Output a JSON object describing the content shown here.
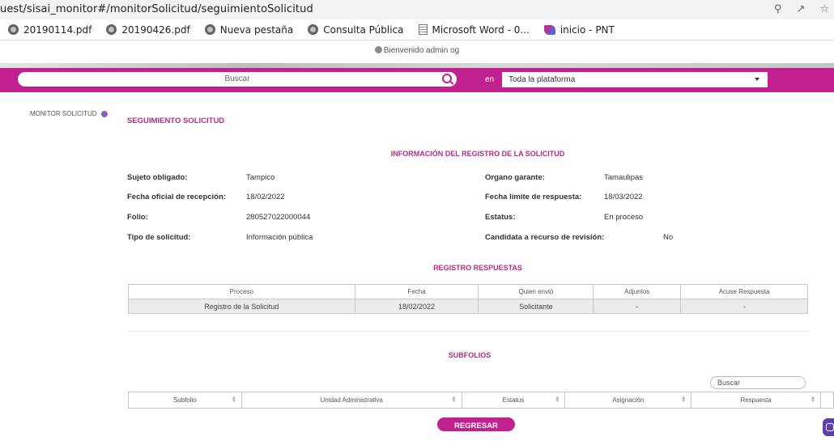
{
  "browser": {
    "url": "uest/sisai_monitor#/monitorSolicitud/seguimientoSolicitud",
    "bookmarks": [
      "20190114.pdf",
      "20190426.pdf",
      "Nueva pestaña",
      "Consulta Pública",
      "Microsoft Word - 0...",
      "inicio - PNT"
    ]
  },
  "header": {
    "welcome": "Bienvenido admin og",
    "search_placeholder": "Buscar",
    "en_label": "en",
    "scope_value": "Toda la plataforma"
  },
  "sidenav": {
    "item": "MONITOR SOLICITUD"
  },
  "page": {
    "title": "SEGUIMIENTO SOLICITUD",
    "info_heading": "INFORMACIÓN DEL REGISTRO DE LA SOLICITUD",
    "fields": {
      "sujeto_label": "Sujeto obligado:",
      "sujeto_value": "Tampico",
      "organo_label": "Organo garante:",
      "organo_value": "Tamaulipas",
      "fecha_rec_label": "Fecha oficial de recepción:",
      "fecha_rec_value": "18/02/2022",
      "fecha_lim_label": "Fecha límite de respuesta:",
      "fecha_lim_value": "18/03/2022",
      "folio_label": "Folio:",
      "folio_value": "280527022000044",
      "estatus_label": "Estatus:",
      "estatus_value": "En proceso",
      "tipo_label": "Tipo de solicitud:",
      "tipo_value": "Información pública",
      "candidata_label": "Candidata a recurso de revisión:",
      "candidata_value": "No"
    },
    "registro_heading": "REGISTRO RESPUESTAS",
    "registro_table": {
      "headers": [
        "Proceso",
        "Fecha",
        "Quien envió",
        "Adjuntos",
        "Acuse Respuesta"
      ],
      "row": [
        "Registro de la Solicitud",
        "18/02/2022",
        "Solicitante",
        "-",
        "-"
      ]
    },
    "subfolios_heading": "SUBFOLIOS",
    "subfolios_search_placeholder": "Buscar",
    "subfolios_table": {
      "headers": [
        "Subfolio",
        "Unidad Administrativa",
        "Estatus",
        "Asignación",
        "Respuesta"
      ]
    },
    "back_button": "REGRESAR"
  }
}
